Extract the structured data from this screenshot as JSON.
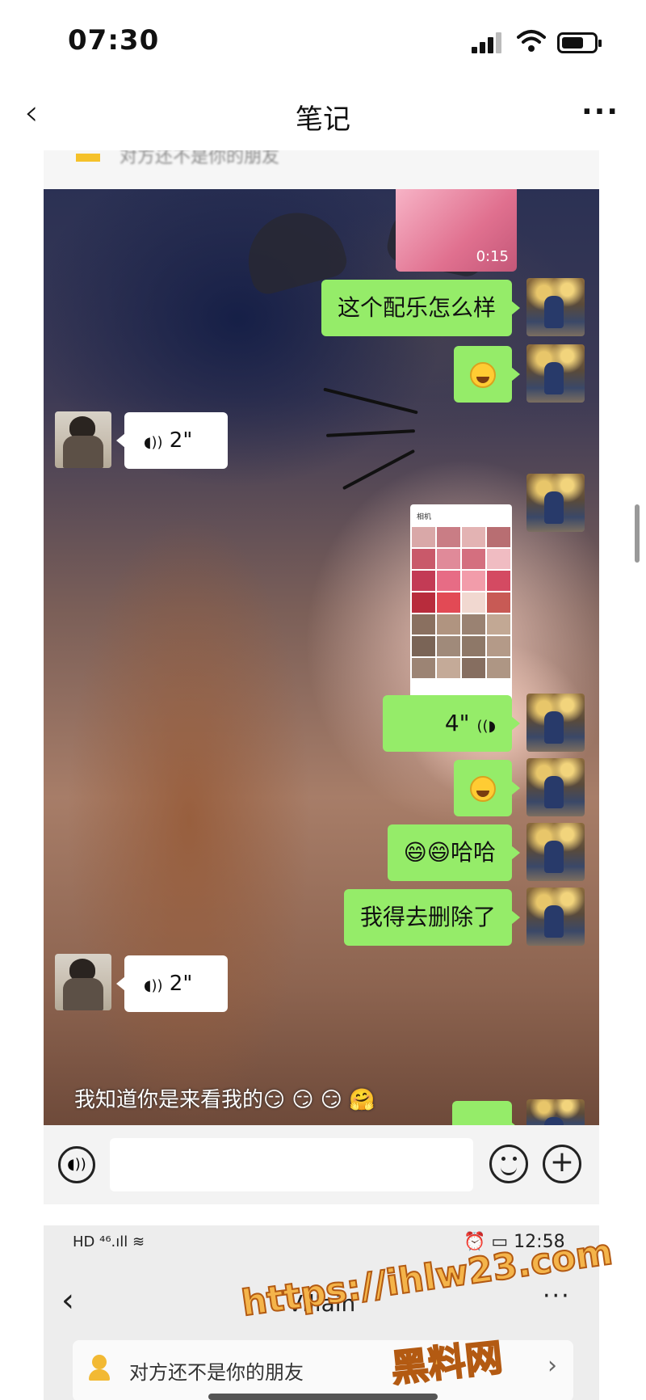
{
  "status_bar": {
    "time": "07:30"
  },
  "nav": {
    "back_glyph": "‹",
    "title": "笔记",
    "more_glyph": "···"
  },
  "chat": {
    "video": {
      "duration": "0:15"
    },
    "messages": [
      {
        "side": "right",
        "type": "text",
        "text": "这个配乐怎么样"
      },
      {
        "side": "right",
        "type": "emoji",
        "text": "😁"
      },
      {
        "side": "left",
        "type": "voice",
        "text": "2\""
      },
      {
        "side": "right",
        "type": "image",
        "text": "相机"
      },
      {
        "side": "right",
        "type": "voice",
        "text": "4\""
      },
      {
        "side": "right",
        "type": "emoji",
        "text": "😅"
      },
      {
        "side": "right",
        "type": "text",
        "text": "😄😄哈哈"
      },
      {
        "side": "right",
        "type": "text",
        "text": "我得去删除了"
      },
      {
        "side": "left",
        "type": "voice",
        "text": "2\""
      }
    ],
    "voice_icon_left": "◖))",
    "voice_icon_right": "((◗",
    "overlay_caption": "我知道你是来看我的😏 😏 😏 🤗"
  },
  "input_bar": {
    "voice_glyph": "◖))",
    "plus_glyph": "+"
  },
  "second_screenshot": {
    "status_left": "HD ⁴⁶.ıll ≋",
    "status_right": "⏰ ▭ 12:58",
    "back_glyph": "‹",
    "title": "Villain",
    "more_glyph": "···",
    "banner_text": "对方还不是你的朋友",
    "banner_arrow": "›"
  },
  "watermark": {
    "url": "https://ihlw23.com",
    "site": "黑料网"
  },
  "icons": [
    "signal-icon",
    "wifi-icon",
    "battery-icon",
    "back-icon",
    "more-icon",
    "voice-icon",
    "emoji-icon",
    "plus-icon",
    "add-friend-icon"
  ],
  "colors": {
    "wechat_green": "#95ec69",
    "watermark_orange": "#f4b44a"
  }
}
